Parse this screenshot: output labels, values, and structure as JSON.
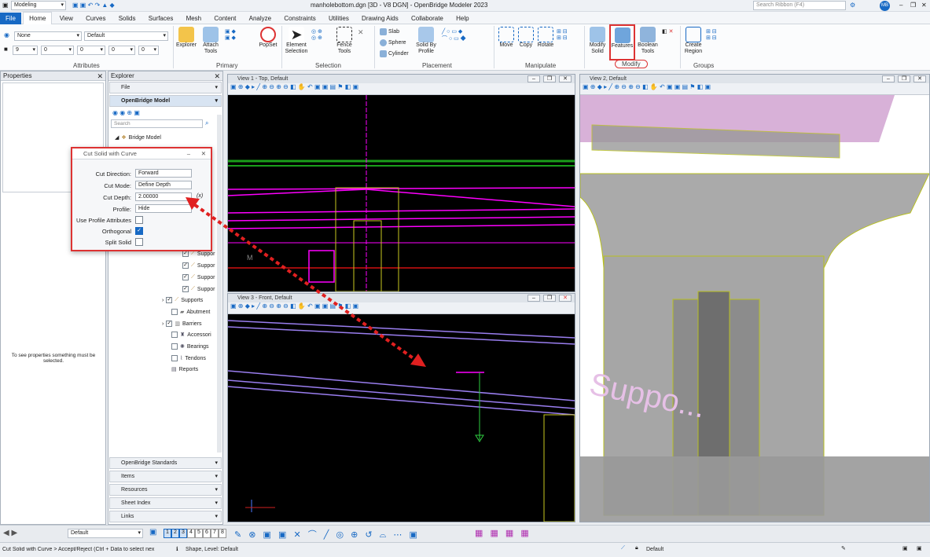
{
  "window": {
    "workflow": "Modeling",
    "title": "manholebottom.dgn [3D - V8 DGN] - OpenBridge Modeler 2023",
    "search_placeholder": "Search Ribbon (F4)",
    "user_initials": "MB"
  },
  "tabs": [
    "File",
    "Home",
    "View",
    "Curves",
    "Solids",
    "Surfaces",
    "Mesh",
    "Content",
    "Analyze",
    "Constraints",
    "Utilities",
    "Drawing Aids",
    "Collaborate",
    "Help"
  ],
  "ribbon": {
    "attributes": {
      "level": "None",
      "style": "Default",
      "color": "9",
      "weight": "0",
      "line": "0",
      "class": "0",
      "transp": "0",
      "label": "Attributes"
    },
    "primary": {
      "explorer": "Explorer",
      "attach_tools": "Attach Tools",
      "popset": "PopSet",
      "label": "Primary"
    },
    "selection": {
      "element_selection": "Element Selection",
      "fence_tools": "Fence Tools",
      "label": "Selection"
    },
    "placement": {
      "slab": "Slab",
      "sphere": "Sphere",
      "cylinder": "Cylinder",
      "solid_by_profile": "Solid By Profile",
      "label": "Placement"
    },
    "manipulate": {
      "move": "Move",
      "copy": "Copy",
      "rotate": "Rotate",
      "label": "Manipulate"
    },
    "modify": {
      "modify_solid": "Modify Solid",
      "features": "Features",
      "boolean_tools": "Boolean Tools",
      "label": "Modify"
    },
    "groups": {
      "create_region": "Create Region",
      "label": "Groups"
    }
  },
  "properties": {
    "title": "Properties",
    "empty_msg": "To see properties something must be selected."
  },
  "explorer": {
    "title": "Explorer",
    "file": "File",
    "section": "OpenBridge Model",
    "search_placeholder": "Search",
    "root": "Bridge Model",
    "items": [
      "Suppor",
      "Suppor",
      "Suppor",
      "Suppor",
      "Supports",
      "Abutment",
      "Barriers",
      "Accessori",
      "Bearings",
      "Tendons",
      "Reports"
    ],
    "sections": [
      "OpenBridge Standards",
      "Items",
      "Resources",
      "Sheet Index",
      "Links"
    ]
  },
  "dialog": {
    "title": "Cut Solid with Curve",
    "cut_direction_label": "Cut Direction:",
    "cut_direction": "Forward",
    "cut_mode_label": "Cut Mode:",
    "cut_mode": "Define Depth",
    "cut_depth_label": "Cut Depth:",
    "cut_depth": "2.00000",
    "profile_label": "Profile:",
    "profile": "Hide",
    "use_profile_label": "Use Profile Attributes",
    "orthogonal_label": "Orthogonal",
    "split_solid_label": "Split Solid",
    "fx": "(x)"
  },
  "views": {
    "v1": "View 1 - Top, Default",
    "v3": "View 3 - Front, Default",
    "v2": "View 2, Default",
    "v2_text": "Suppo..."
  },
  "bottom": {
    "view_attr": "Default",
    "view_numbers": [
      "1",
      "2",
      "3",
      "4",
      "5",
      "6",
      "7",
      "8"
    ]
  },
  "status": {
    "prompt": "Cut Solid with Curve > Accept/Reject (Ctrl + Data to select nex",
    "element": "Shape, Level: Default",
    "level": "Default"
  },
  "colors": {
    "accent": "#1769c4",
    "highlight": "#e02020",
    "magenta": "#ff00ff"
  }
}
